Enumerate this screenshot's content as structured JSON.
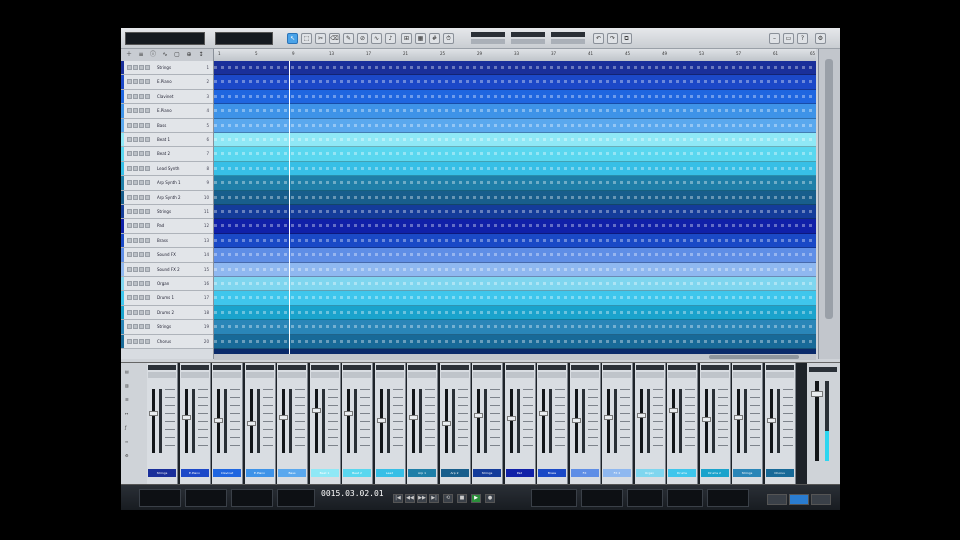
{
  "toolbar": {
    "tools": [
      "arrow",
      "range",
      "split",
      "eraser",
      "paint",
      "mute",
      "bend",
      "listen"
    ],
    "active_tool": "arrow"
  },
  "ruler": {
    "marks": [
      "1",
      "5",
      "9",
      "13",
      "17",
      "21",
      "25",
      "29",
      "33",
      "37",
      "41",
      "45",
      "49",
      "53",
      "57",
      "61",
      "65"
    ]
  },
  "tracks": [
    {
      "name": "Strings",
      "num": "1",
      "color": "#1a2f9a"
    },
    {
      "name": "E.Piano",
      "num": "2",
      "color": "#1c48c8"
    },
    {
      "name": "Clavinet",
      "num": "3",
      "color": "#1f66e0"
    },
    {
      "name": "E.Piano",
      "num": "4",
      "color": "#3e93e8"
    },
    {
      "name": "Bass",
      "num": "5",
      "color": "#5aa8ee"
    },
    {
      "name": "Beat 1",
      "num": "6",
      "color": "#8fe8f6"
    },
    {
      "name": "Beat 2",
      "num": "7",
      "color": "#5ad7ef"
    },
    {
      "name": "Lead Synth",
      "num": "8",
      "color": "#37bfe6"
    },
    {
      "name": "Arp Synth 1",
      "num": "9",
      "color": "#1f7fa8"
    },
    {
      "name": "Arp Synth 2",
      "num": "10",
      "color": "#185e8c"
    },
    {
      "name": "Strings",
      "num": "11",
      "color": "#143c9a"
    },
    {
      "name": "Pad",
      "num": "12",
      "color": "#1020a8"
    },
    {
      "name": "Brass",
      "num": "13",
      "color": "#1a49c6"
    },
    {
      "name": "Sound FX",
      "num": "14",
      "color": "#5f8ee6"
    },
    {
      "name": "Sound FX 2",
      "num": "15",
      "color": "#8fb8f0"
    },
    {
      "name": "Organ",
      "num": "16",
      "color": "#7fd6ef"
    },
    {
      "name": "Drums 1",
      "num": "17",
      "color": "#3fc6ec"
    },
    {
      "name": "Drums 2",
      "num": "18",
      "color": "#1aa3cc"
    },
    {
      "name": "Strings",
      "num": "19",
      "color": "#2a86b8"
    },
    {
      "name": "Chorus",
      "num": "20",
      "color": "#186a98"
    }
  ],
  "mixer": {
    "strips": [
      {
        "label": "Strings",
        "color": "#1a2f9a",
        "fader": 0.65
      },
      {
        "label": "E.Piano",
        "color": "#1c48c8",
        "fader": 0.6
      },
      {
        "label": "Clavinet",
        "color": "#1f66e0",
        "fader": 0.55
      },
      {
        "label": "E.Piano",
        "color": "#3e93e8",
        "fader": 0.5
      },
      {
        "label": "Bass",
        "color": "#5aa8ee",
        "fader": 0.6
      },
      {
        "label": "Beat 1",
        "color": "#8fe8f6",
        "fader": 0.7
      },
      {
        "label": "Beat 2",
        "color": "#5ad7ef",
        "fader": 0.65
      },
      {
        "label": "Lead",
        "color": "#37bfe6",
        "fader": 0.55
      },
      {
        "label": "Arp 1",
        "color": "#1f7fa8",
        "fader": 0.6
      },
      {
        "label": "Arp 2",
        "color": "#185e8c",
        "fader": 0.5
      },
      {
        "label": "Strings",
        "color": "#143c9a",
        "fader": 0.62
      },
      {
        "label": "Pad",
        "color": "#1020a8",
        "fader": 0.58
      },
      {
        "label": "Brass",
        "color": "#1a49c6",
        "fader": 0.66
      },
      {
        "label": "FX",
        "color": "#5f8ee6",
        "fader": 0.54
      },
      {
        "label": "FX 2",
        "color": "#8fb8f0",
        "fader": 0.6
      },
      {
        "label": "Organ",
        "color": "#7fd6ef",
        "fader": 0.63
      },
      {
        "label": "Drums",
        "color": "#3fc6ec",
        "fader": 0.7
      },
      {
        "label": "Drums 2",
        "color": "#1aa3cc",
        "fader": 0.57
      },
      {
        "label": "Strings",
        "color": "#2a86b8",
        "fader": 0.6
      },
      {
        "label": "Chorus",
        "color": "#186a98",
        "fader": 0.55
      }
    ]
  },
  "transport": {
    "time": "0015.03.02.01"
  }
}
